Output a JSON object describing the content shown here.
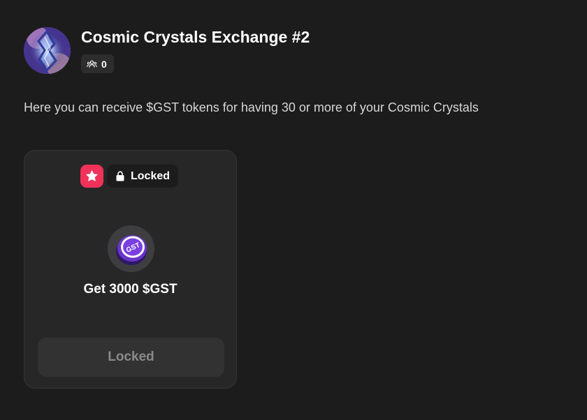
{
  "quest": {
    "title": "Cosmic Crystals Exchange #2",
    "participants_icon": "people-icon",
    "participants_count": "0",
    "avatar_icon": "crystal-avatar-image",
    "description": "Here you can receive $GST tokens for having 30 or more of your Cosmic Crystals"
  },
  "card": {
    "badge_icon": "star-icon",
    "badge_color": "#f0325a",
    "status_icon": "lock-icon",
    "status_label": "Locked",
    "token_icon": "gst-token-icon",
    "token_text": "GST",
    "reward_text": "Get 3000 $GST",
    "button_label": "Locked"
  }
}
